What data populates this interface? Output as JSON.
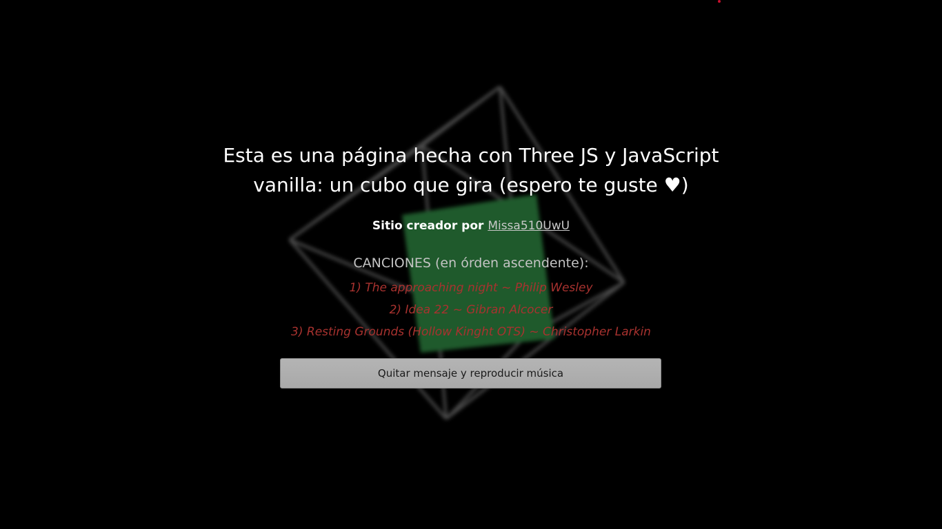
{
  "intro": {
    "title": "Esta es una página hecha con Three JS y JavaScript vanilla: un cubo que gira (espero te guste ♥)",
    "credit_prefix": "Sitio creador por ",
    "credit_link": "Missa510UwU"
  },
  "songs": {
    "heading": "CANCIONES (en órden ascendente):",
    "items": [
      "1) The approaching night ~ Philip Wesley",
      "2) Idea 22 ~ Gibran Alcocer",
      "3) Resting Grounds (Hollow Kinght OTS) ~ Christopher Larkin"
    ]
  },
  "actions": {
    "dismiss_play_label": "Quitar mensaje y reproducir música"
  },
  "colors": {
    "background": "#000000",
    "cube_face": "#1f5a2c",
    "wireframe": "#4a4a4a",
    "song_text": "#a8322f",
    "accent_dot": "#c8102e"
  },
  "icons": {
    "heart": "heart-icon"
  }
}
